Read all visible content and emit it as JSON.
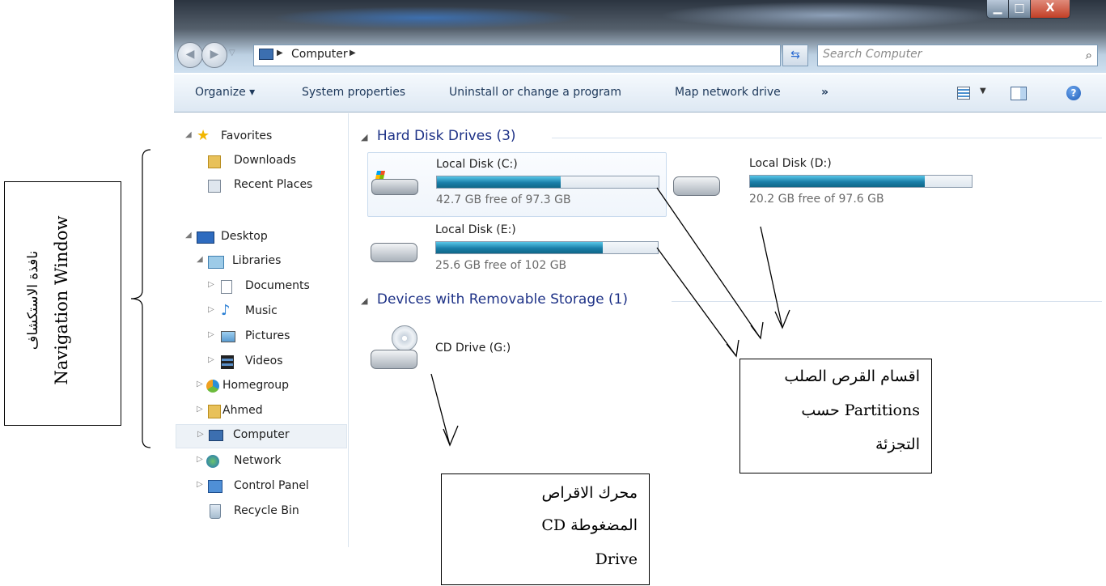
{
  "window": {
    "controls": {
      "minimize": "▁",
      "maximize": "□",
      "close": "X"
    }
  },
  "address": {
    "path": "Computer",
    "search_placeholder": "Search Computer"
  },
  "toolbar": {
    "organize": "Organize ▾",
    "system_properties": "System properties",
    "uninstall": "Uninstall or change a program",
    "map_drive": "Map network drive",
    "more": "»"
  },
  "nav": {
    "favorites": "Favorites",
    "downloads": "Downloads",
    "recent_places": "Recent Places",
    "desktop": "Desktop",
    "libraries": "Libraries",
    "documents": "Documents",
    "music": "Music",
    "pictures": "Pictures",
    "videos": "Videos",
    "homegroup": "Homegroup",
    "ahmed": "Ahmed",
    "computer": "Computer",
    "network": "Network",
    "control_panel": "Control Panel",
    "recycle_bin": "Recycle Bin"
  },
  "content": {
    "hdd_group": "Hard Disk Drives (3)",
    "removable_group": "Devices with Removable Storage (1)",
    "disks": [
      {
        "name": "Local Disk (C:)",
        "free": "42.7 GB free of 97.3 GB",
        "used_fraction": 0.56
      },
      {
        "name": "Local Disk (D:)",
        "free": "20.2 GB free of 97.6 GB",
        "used_fraction": 0.79
      },
      {
        "name": "Local Disk (E:)",
        "free": "25.6 GB free of 102 GB",
        "used_fraction": 0.75
      }
    ],
    "cd_drive": "CD Drive (G:)"
  },
  "annotations": {
    "nav_window_en": "Navigation Window",
    "nav_window_ar": "نافذة الاستكشاف",
    "partitions_line1": "اقسام القرص الصلب",
    "partitions_line2": "Partitions حسب",
    "partitions_line3": "التجزئة",
    "cd_line1": "محرك الاقراص",
    "cd_line2": "المضغوطة CD",
    "cd_line3": "Drive"
  },
  "colors": {
    "group_header": "#1e3287",
    "bar_fill": "#1a7fa9",
    "link_text": "#1e395b"
  }
}
